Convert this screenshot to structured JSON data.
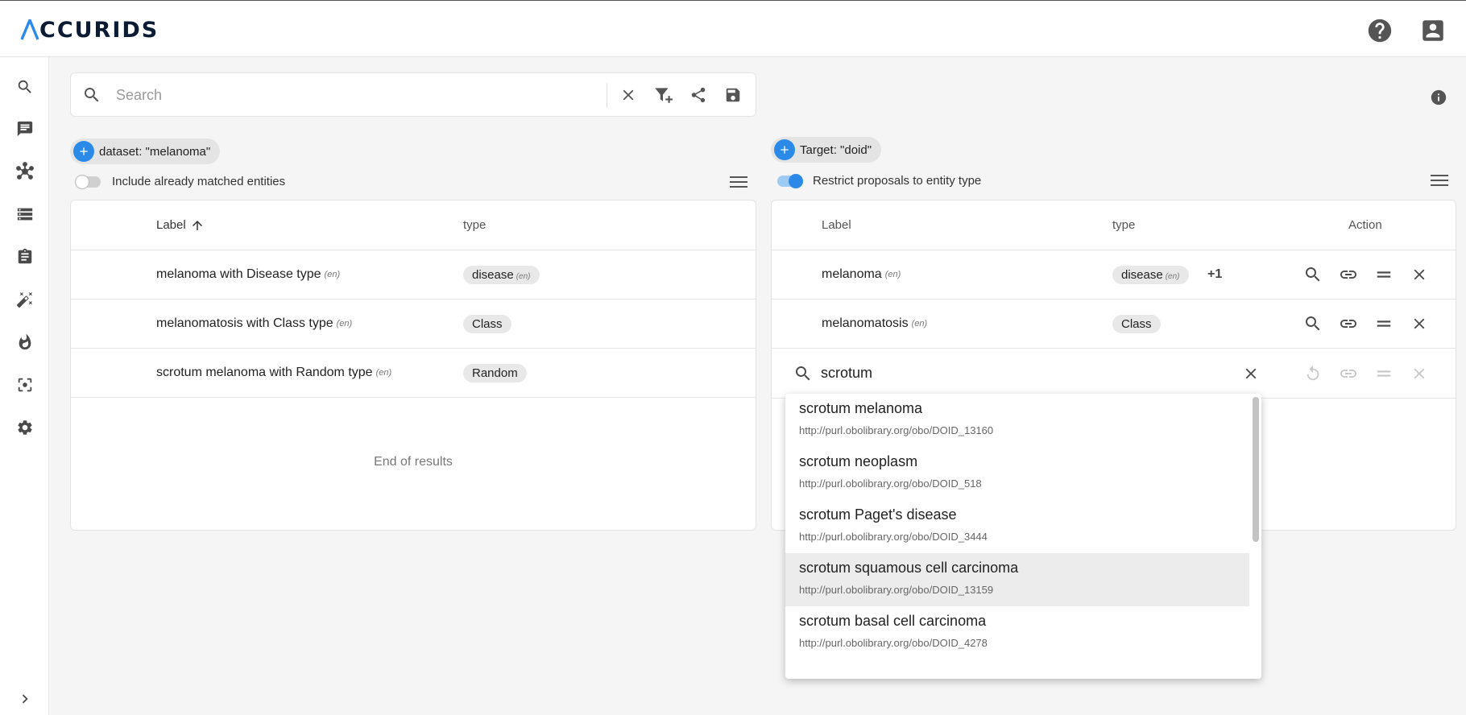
{
  "app": {
    "logo_text": "CCURIDS"
  },
  "topbar": {
    "help_icon": "help-circle-icon",
    "account_icon": "account-box-icon"
  },
  "sidebar": {
    "items": [
      {
        "icon": "search-icon"
      },
      {
        "icon": "message-icon"
      },
      {
        "icon": "graph-network-icon"
      },
      {
        "icon": "storage-list-icon"
      },
      {
        "icon": "clipboard-icon"
      },
      {
        "icon": "magic-wand-icon"
      },
      {
        "icon": "fire-icon"
      },
      {
        "icon": "center-focus-icon"
      },
      {
        "icon": "settings-gear-icon"
      }
    ],
    "expand_icon": "chevron-right-icon"
  },
  "search": {
    "placeholder": "Search",
    "value": ""
  },
  "left": {
    "chip_label": "dataset: \"melanoma\"",
    "toggle_label": "Include already matched entities",
    "toggle_on": false,
    "columns": {
      "label": "Label",
      "type": "type"
    },
    "rows": [
      {
        "label": "melanoma with Disease type",
        "lang": "(en)",
        "type": "disease",
        "type_lang": "(en)"
      },
      {
        "label": "melanomatosis with Class type",
        "lang": "(en)",
        "type": "Class",
        "type_lang": ""
      },
      {
        "label": "scrotum melanoma with Random type",
        "lang": "(en)",
        "type": "Random",
        "type_lang": ""
      }
    ],
    "end_text": "End of results"
  },
  "right": {
    "chip_label": "Target: \"doid\"",
    "toggle_label": "Restrict proposals to entity type",
    "toggle_on": true,
    "columns": {
      "label": "Label",
      "type": "type",
      "action": "Action"
    },
    "rows": [
      {
        "label": "melanoma",
        "lang": "(en)",
        "type": "disease",
        "type_lang": "(en)",
        "extra": "+1"
      },
      {
        "label": "melanomatosis",
        "lang": "(en)",
        "type": "Class",
        "type_lang": "",
        "extra": ""
      }
    ],
    "inline_search_value": "scrotum"
  },
  "dropdown": {
    "options": [
      {
        "label": "scrotum melanoma",
        "url": "http://purl.obolibrary.org/obo/DOID_13160",
        "highlighted": false
      },
      {
        "label": "scrotum neoplasm",
        "url": "http://purl.obolibrary.org/obo/DOID_518",
        "highlighted": false
      },
      {
        "label": "scrotum Paget's disease",
        "url": "http://purl.obolibrary.org/obo/DOID_3444",
        "highlighted": false
      },
      {
        "label": "scrotum squamous cell carcinoma",
        "url": "http://purl.obolibrary.org/obo/DOID_13159",
        "highlighted": true
      },
      {
        "label": "scrotum basal cell carcinoma",
        "url": "http://purl.obolibrary.org/obo/DOID_4278",
        "highlighted": false
      }
    ]
  },
  "colors": {
    "accent": "#2b8ae8",
    "icon": "#4a4a4a",
    "disabled": "#c8c8c8"
  }
}
